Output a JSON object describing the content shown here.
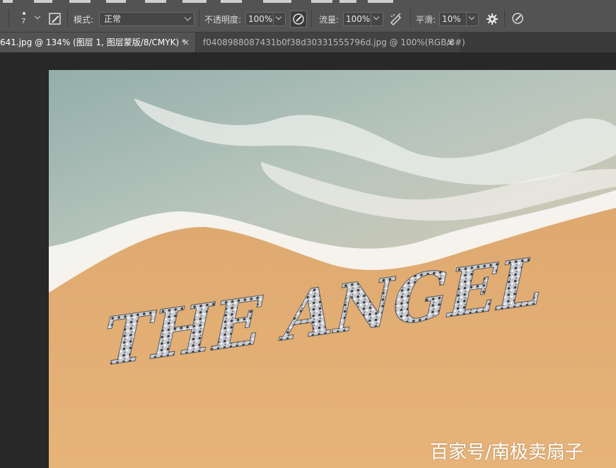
{
  "options_bar": {
    "brush_size": "7",
    "mode_label": "模式:",
    "mode_value": "正常",
    "opacity_label": "不透明度:",
    "opacity_value": "100%",
    "flow_label": "流量:",
    "flow_value": "100%",
    "smoothing_label": "平滑:",
    "smoothing_value": "10%",
    "icons": [
      "brush-preset-icon",
      "brush-panel-icon",
      "pressure-opacity-icon",
      "airbrush-icon",
      "smoothing-settings-gear-icon",
      "pressure-size-icon"
    ]
  },
  "tabs": [
    {
      "title": "641.jpg @ 134% (图层 1, 图层蒙版/8/CMYK) *",
      "close": "×",
      "active": true
    },
    {
      "title": "f0408988087431b0f38d30331555796d.jpg @ 100%(RGB/8#)",
      "close": "×",
      "active": false
    }
  ],
  "canvas": {
    "sand_text": "THE ANGEL",
    "colors": {
      "sand": "#e2ad72",
      "sea": "#a9bdb6",
      "foam": "#f7f7f4"
    }
  },
  "watermark": "百家号/南极卖扇子"
}
